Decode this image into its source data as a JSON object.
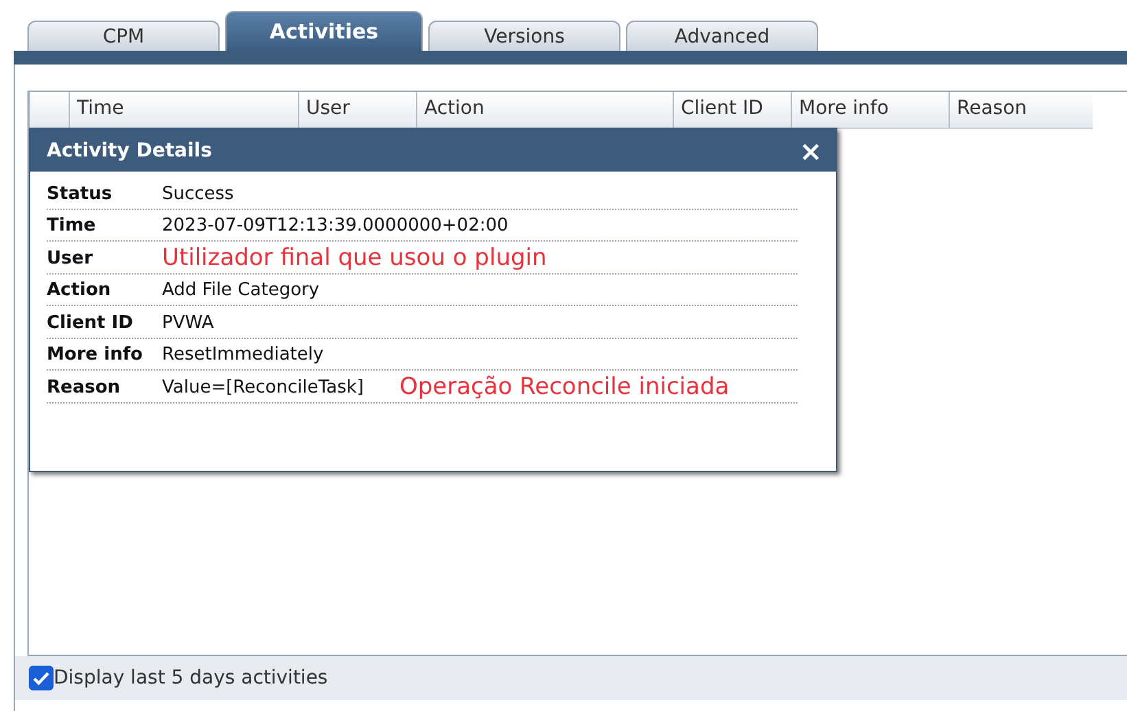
{
  "tabs": [
    {
      "label": "CPM",
      "selected": false
    },
    {
      "label": "Activities",
      "selected": true
    },
    {
      "label": "Versions",
      "selected": false
    },
    {
      "label": "Advanced",
      "selected": false
    }
  ],
  "table": {
    "columns": [
      "Time",
      "User",
      "Action",
      "Client ID",
      "More info",
      "Reason"
    ]
  },
  "dialog": {
    "title": "Activity Details",
    "close": "×",
    "rows": [
      {
        "label": "Status",
        "value": "Success"
      },
      {
        "label": "Time",
        "value": "2023-07-09T12:13:39.0000000+02:00"
      },
      {
        "label": "User",
        "annotation": "Utilizador final que usou o plugin"
      },
      {
        "label": "Action",
        "value": "Add File Category"
      },
      {
        "label": "Client ID",
        "value": "PVWA"
      },
      {
        "label": "More info",
        "value": "ResetImmediately"
      },
      {
        "label": "Reason",
        "value": "Value=[ReconcileTask]",
        "annotation": "Operação Reconcile iniciada"
      }
    ]
  },
  "footer": {
    "checkbox": {
      "label": "Display last 5 days activities",
      "checked": true
    }
  }
}
